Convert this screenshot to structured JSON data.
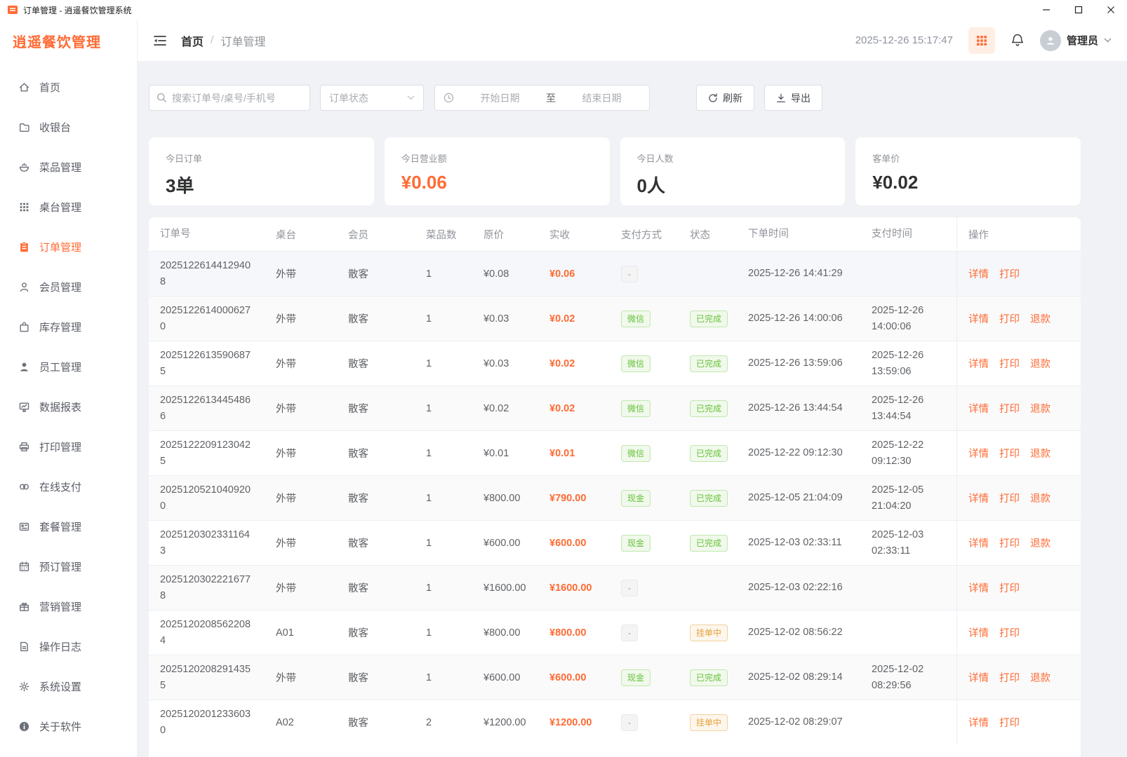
{
  "titlebar": {
    "title": "订单管理 - 逍遥餐饮管理系统"
  },
  "sidebar": {
    "logo": "逍遥餐饮管理",
    "items": [
      {
        "name": "home",
        "label": "首页",
        "active": false
      },
      {
        "name": "cashier",
        "label": "收银台",
        "active": false
      },
      {
        "name": "dishes",
        "label": "菜品管理",
        "active": false
      },
      {
        "name": "tables",
        "label": "桌台管理",
        "active": false
      },
      {
        "name": "orders",
        "label": "订单管理",
        "active": true
      },
      {
        "name": "members",
        "label": "会员管理",
        "active": false
      },
      {
        "name": "inventory",
        "label": "库存管理",
        "active": false
      },
      {
        "name": "staff",
        "label": "员工管理",
        "active": false
      },
      {
        "name": "reports",
        "label": "数据报表",
        "active": false
      },
      {
        "name": "print",
        "label": "打印管理",
        "active": false
      },
      {
        "name": "payment",
        "label": "在线支付",
        "active": false
      },
      {
        "name": "combo",
        "label": "套餐管理",
        "active": false
      },
      {
        "name": "reservation",
        "label": "预订管理",
        "active": false
      },
      {
        "name": "marketing",
        "label": "营销管理",
        "active": false
      },
      {
        "name": "logs",
        "label": "操作日志",
        "active": false
      },
      {
        "name": "settings",
        "label": "系统设置",
        "active": false
      },
      {
        "name": "about",
        "label": "关于软件",
        "active": false
      }
    ]
  },
  "header": {
    "breadcrumb": [
      "首页",
      "订单管理"
    ],
    "breadcrumb_separator": "/",
    "timestamp": "2025-12-26 15:17:47",
    "user": "管理员"
  },
  "filters": {
    "search_placeholder": "搜索订单号/桌号/手机号",
    "status_placeholder": "订单状态",
    "date_start_placeholder": "开始日期",
    "date_separator": "至",
    "date_end_placeholder": "结束日期",
    "refresh_label": "刷新",
    "export_label": "导出"
  },
  "stats": [
    {
      "label": "今日订单",
      "value": "3单",
      "accent": false
    },
    {
      "label": "今日营业额",
      "value": "¥0.06",
      "accent": true
    },
    {
      "label": "今日人数",
      "value": "0人",
      "accent": false
    },
    {
      "label": "客单价",
      "value": "¥0.02",
      "accent": false
    }
  ],
  "table": {
    "columns": [
      "订单号",
      "桌台",
      "会员",
      "菜品数",
      "原价",
      "实收",
      "支付方式",
      "状态",
      "下单时间",
      "支付时间",
      "操作"
    ],
    "rows": [
      {
        "order_no": "20251226144129408",
        "table": "外带",
        "member": "散客",
        "dish_count": "1",
        "original": "¥0.08",
        "actual": "¥0.06",
        "payment": "-",
        "status": "",
        "order_time": "2025-12-26 14:41:29",
        "pay_time": "",
        "actions": [
          "详情",
          "打印"
        ]
      },
      {
        "order_no": "20251226140006270",
        "table": "外带",
        "member": "散客",
        "dish_count": "1",
        "original": "¥0.03",
        "actual": "¥0.02",
        "payment": "微信",
        "status": "已完成",
        "order_time": "2025-12-26 14:00:06",
        "pay_time": "2025-12-26 14:00:06",
        "actions": [
          "详情",
          "打印",
          "退款"
        ]
      },
      {
        "order_no": "20251226135906875",
        "table": "外带",
        "member": "散客",
        "dish_count": "1",
        "original": "¥0.03",
        "actual": "¥0.02",
        "payment": "微信",
        "status": "已完成",
        "order_time": "2025-12-26 13:59:06",
        "pay_time": "2025-12-26 13:59:06",
        "actions": [
          "详情",
          "打印",
          "退款"
        ]
      },
      {
        "order_no": "20251226134454866",
        "table": "外带",
        "member": "散客",
        "dish_count": "1",
        "original": "¥0.02",
        "actual": "¥0.02",
        "payment": "微信",
        "status": "已完成",
        "order_time": "2025-12-26 13:44:54",
        "pay_time": "2025-12-26 13:44:54",
        "actions": [
          "详情",
          "打印",
          "退款"
        ]
      },
      {
        "order_no": "20251222091230425",
        "table": "外带",
        "member": "散客",
        "dish_count": "1",
        "original": "¥0.01",
        "actual": "¥0.01",
        "payment": "微信",
        "status": "已完成",
        "order_time": "2025-12-22 09:12:30",
        "pay_time": "2025-12-22 09:12:30",
        "actions": [
          "详情",
          "打印",
          "退款"
        ]
      },
      {
        "order_no": "20251205210409200",
        "table": "外带",
        "member": "散客",
        "dish_count": "1",
        "original": "¥800.00",
        "actual": "¥790.00",
        "payment": "现金",
        "status": "已完成",
        "order_time": "2025-12-05 21:04:09",
        "pay_time": "2025-12-05 21:04:20",
        "actions": [
          "详情",
          "打印",
          "退款"
        ]
      },
      {
        "order_no": "20251203023311643",
        "table": "外带",
        "member": "散客",
        "dish_count": "1",
        "original": "¥600.00",
        "actual": "¥600.00",
        "payment": "现金",
        "status": "已完成",
        "order_time": "2025-12-03 02:33:11",
        "pay_time": "2025-12-03 02:33:11",
        "actions": [
          "详情",
          "打印",
          "退款"
        ]
      },
      {
        "order_no": "20251203022216778",
        "table": "外带",
        "member": "散客",
        "dish_count": "1",
        "original": "¥1600.00",
        "actual": "¥1600.00",
        "payment": "-",
        "status": "",
        "order_time": "2025-12-03 02:22:16",
        "pay_time": "",
        "actions": [
          "详情",
          "打印"
        ]
      },
      {
        "order_no": "20251202085622084",
        "table": "A01",
        "member": "散客",
        "dish_count": "1",
        "original": "¥800.00",
        "actual": "¥800.00",
        "payment": "-",
        "status": "挂单中",
        "order_time": "2025-12-02 08:56:22",
        "pay_time": "",
        "actions": [
          "详情",
          "打印"
        ]
      },
      {
        "order_no": "20251202082914355",
        "table": "外带",
        "member": "散客",
        "dish_count": "1",
        "original": "¥600.00",
        "actual": "¥600.00",
        "payment": "现金",
        "status": "已完成",
        "order_time": "2025-12-02 08:29:14",
        "pay_time": "2025-12-02 08:29:56",
        "actions": [
          "详情",
          "打印",
          "退款"
        ]
      },
      {
        "order_no": "20251202012336030",
        "table": "A02",
        "member": "散客",
        "dish_count": "2",
        "original": "¥1200.00",
        "actual": "¥1200.00",
        "payment": "-",
        "status": "挂单中",
        "order_time": "2025-12-02 08:29:07",
        "pay_time": "",
        "actions": [
          "详情",
          "打印"
        ]
      }
    ]
  },
  "colors": {
    "accent": "#ff6b35",
    "success": "#67c23a",
    "warning": "#e6a23c",
    "info": "#909399",
    "page_bg": "#f0f2f5"
  }
}
